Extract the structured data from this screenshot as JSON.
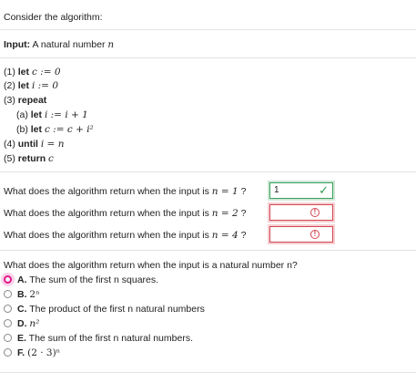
{
  "intro": "Consider the algorithm:",
  "input_label": "Input:",
  "input_text": "A natural number ",
  "steps": [
    {
      "num": "(1)",
      "kw": "let",
      "expr": "c := 0"
    },
    {
      "num": "(2)",
      "kw": "let",
      "expr": "i := 0"
    },
    {
      "num": "(3)",
      "kw": "repeat",
      "expr": ""
    },
    {
      "num": "(a)",
      "kw": "let",
      "expr": "i := i + 1"
    },
    {
      "num": "(b)",
      "kw": "let",
      "expr": "c := c + i²"
    },
    {
      "num": "(4)",
      "kw": "until",
      "expr": "i = n"
    },
    {
      "num": "(5)",
      "kw": "return",
      "expr": "c"
    }
  ],
  "questions": [
    {
      "prefix": "What does the algorithm return when the input is ",
      "cond": "n = 1",
      "suffix": " ?",
      "value": "1",
      "status": "correct"
    },
    {
      "prefix": "What does the algorithm return when the input is ",
      "cond": "n = 2",
      "suffix": " ?",
      "value": "",
      "status": "incorrect"
    },
    {
      "prefix": "What does the algorithm return when the input is ",
      "cond": "n = 4",
      "suffix": " ?",
      "value": "",
      "status": "incorrect"
    }
  ],
  "mc_question": "What does the algorithm return when the input is a natural number n?",
  "options": [
    {
      "letter": "A.",
      "text": "The sum of the first n squares.",
      "selected": true
    },
    {
      "letter": "B.",
      "text": "2ⁿ",
      "selected": false
    },
    {
      "letter": "C.",
      "text": "The product of the first n natural numbers",
      "selected": false
    },
    {
      "letter": "D.",
      "text": "n²",
      "selected": false
    },
    {
      "letter": "E.",
      "text": "The sum of the first n natural numbers.",
      "selected": false
    },
    {
      "letter": "F.",
      "text": "(2 · 3)ⁿ",
      "selected": false
    }
  ],
  "colors": {
    "correct": "#3aa05a",
    "incorrect": "#d64550",
    "selected_radio": "#e2188a"
  },
  "icons": {
    "correct": "checkmark-icon",
    "incorrect": "exclamation-circle-icon"
  }
}
